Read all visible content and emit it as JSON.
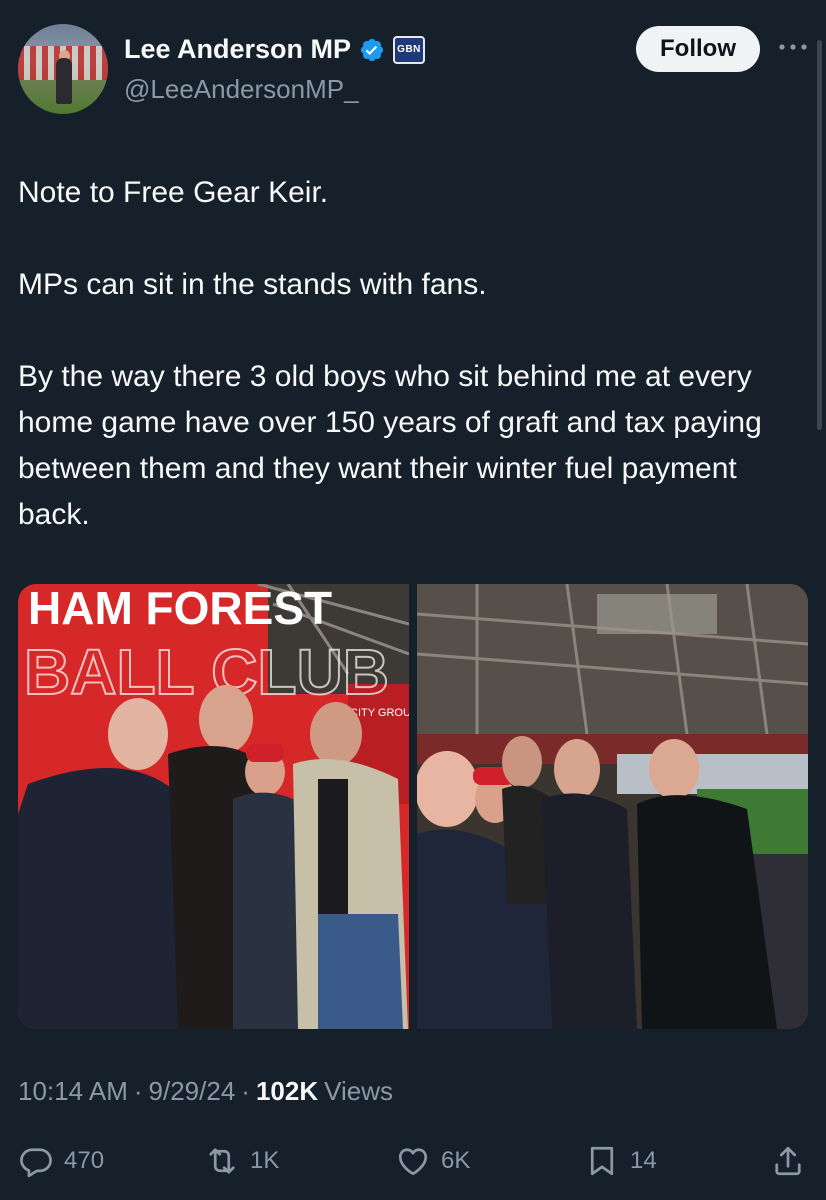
{
  "author": {
    "display_name": "Lee Anderson MP",
    "handle": "@LeeAndersonMP_",
    "affiliation_badge": "GBN",
    "verified_color": "#1d9bf0"
  },
  "follow_label": "Follow",
  "tweet": {
    "paragraphs": [
      "Note to Free Gear Keir.",
      "MPs can sit in the stands with fans.",
      "By the way there 3 old boys who sit behind me at every home game have over 150 years of graft and tax paying between them and they want their winter fuel payment back."
    ]
  },
  "photos": {
    "left_banner_top": "HAM FOREST",
    "left_banner_bottom": "BALL CLUB",
    "side_board": "CITY GROUND"
  },
  "meta": {
    "time": "10:14 AM",
    "separator": "·",
    "date": "9/29/24",
    "views_count": "102K",
    "views_label": "Views"
  },
  "actions": {
    "replies": "470",
    "reposts": "1K",
    "likes": "6K",
    "bookmarks": "14"
  },
  "icons": [
    "more-icon",
    "verified-icon",
    "reply-icon",
    "repost-icon",
    "like-icon",
    "bookmark-icon",
    "share-icon"
  ]
}
